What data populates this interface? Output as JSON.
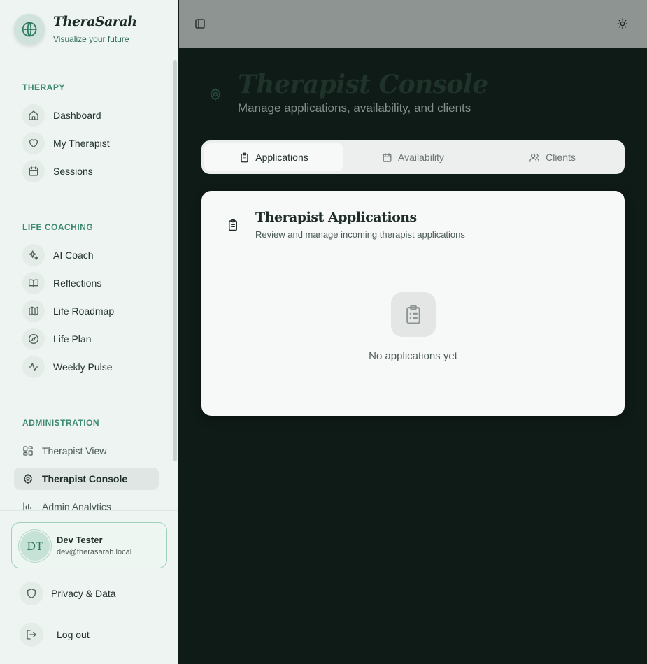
{
  "brand": {
    "name": "TheraSarah",
    "tagline": "Visualize your future",
    "logo_icon": "globe-icon"
  },
  "sidebar": {
    "sections": [
      {
        "label": "THERAPY",
        "items": [
          {
            "label": "Dashboard",
            "icon": "home-icon"
          },
          {
            "label": "My Therapist",
            "icon": "heart-icon"
          },
          {
            "label": "Sessions",
            "icon": "calendar-icon"
          }
        ]
      },
      {
        "label": "LIFE COACHING",
        "items": [
          {
            "label": "AI Coach",
            "icon": "sparkles-icon"
          },
          {
            "label": "Reflections",
            "icon": "book-open-icon"
          },
          {
            "label": "Life Roadmap",
            "icon": "map-icon"
          },
          {
            "label": "Life Plan",
            "icon": "compass-icon"
          },
          {
            "label": "Weekly Pulse",
            "icon": "activity-icon"
          }
        ]
      },
      {
        "label": "ADMINISTRATION",
        "items": [
          {
            "label": "Therapist View",
            "icon": "layout-grid-icon"
          },
          {
            "label": "Therapist Console",
            "icon": "gear-icon",
            "active": true
          },
          {
            "label": "Admin Analytics",
            "icon": "bar-chart-icon"
          }
        ]
      }
    ]
  },
  "user": {
    "initials": "DT",
    "name": "Dev Tester",
    "email": "dev@therasarah.local"
  },
  "footer": {
    "privacy_label": "Privacy & Data",
    "logout_label": "Log out"
  },
  "header": {
    "toggle_icon": "panel-left-icon",
    "theme_icon": "sun-icon"
  },
  "page": {
    "title": "Therapist Console",
    "subtitle": "Manage applications, availability, and clients",
    "icon": "gear-icon"
  },
  "tabs": [
    {
      "label": "Applications",
      "icon": "clipboard-list-icon",
      "active": true
    },
    {
      "label": "Availability",
      "icon": "calendar-icon"
    },
    {
      "label": "Clients",
      "icon": "users-icon"
    }
  ],
  "card": {
    "title": "Therapist Applications",
    "subtitle": "Review and manage incoming therapist applications",
    "empty_text": "No applications yet"
  },
  "colors": {
    "accent": "#3c8a6e",
    "sidebar_bg": "#eef4f1",
    "main_bg": "#0f1b17"
  }
}
